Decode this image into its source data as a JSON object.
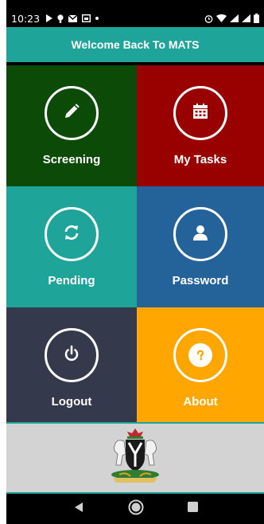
{
  "status_bar": {
    "time": "10:23"
  },
  "header": {
    "title": "Welcome Back To MATS"
  },
  "tiles": [
    {
      "label": "Screening",
      "icon": "pencil-icon",
      "color": "#0b4b07"
    },
    {
      "label": "My Tasks",
      "icon": "calendar-icon",
      "color": "#990000"
    },
    {
      "label": "Pending",
      "icon": "refresh-icon",
      "color": "#1fa49a"
    },
    {
      "label": "Password",
      "icon": "user-icon",
      "color": "#24629a"
    },
    {
      "label": "Logout",
      "icon": "power-icon",
      "color": "#343a4c"
    },
    {
      "label": "About",
      "icon": "question-icon",
      "color": "#ffa600"
    }
  ],
  "colors": {
    "accent": "#1fa49a"
  },
  "footer": {
    "emblem": "coat-of-arms-icon"
  }
}
